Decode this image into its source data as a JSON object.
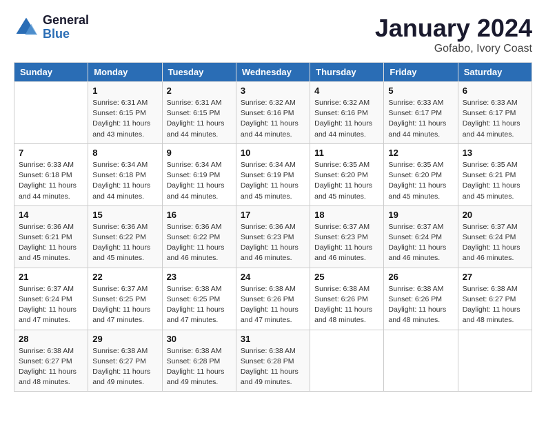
{
  "logo": {
    "line1": "General",
    "line2": "Blue"
  },
  "title": "January 2024",
  "location": "Gofabo, Ivory Coast",
  "days_of_week": [
    "Sunday",
    "Monday",
    "Tuesday",
    "Wednesday",
    "Thursday",
    "Friday",
    "Saturday"
  ],
  "weeks": [
    [
      {
        "num": "",
        "sunrise": "",
        "sunset": "",
        "daylight": ""
      },
      {
        "num": "1",
        "sunrise": "Sunrise: 6:31 AM",
        "sunset": "Sunset: 6:15 PM",
        "daylight": "Daylight: 11 hours and 43 minutes."
      },
      {
        "num": "2",
        "sunrise": "Sunrise: 6:31 AM",
        "sunset": "Sunset: 6:15 PM",
        "daylight": "Daylight: 11 hours and 44 minutes."
      },
      {
        "num": "3",
        "sunrise": "Sunrise: 6:32 AM",
        "sunset": "Sunset: 6:16 PM",
        "daylight": "Daylight: 11 hours and 44 minutes."
      },
      {
        "num": "4",
        "sunrise": "Sunrise: 6:32 AM",
        "sunset": "Sunset: 6:16 PM",
        "daylight": "Daylight: 11 hours and 44 minutes."
      },
      {
        "num": "5",
        "sunrise": "Sunrise: 6:33 AM",
        "sunset": "Sunset: 6:17 PM",
        "daylight": "Daylight: 11 hours and 44 minutes."
      },
      {
        "num": "6",
        "sunrise": "Sunrise: 6:33 AM",
        "sunset": "Sunset: 6:17 PM",
        "daylight": "Daylight: 11 hours and 44 minutes."
      }
    ],
    [
      {
        "num": "7",
        "sunrise": "Sunrise: 6:33 AM",
        "sunset": "Sunset: 6:18 PM",
        "daylight": "Daylight: 11 hours and 44 minutes."
      },
      {
        "num": "8",
        "sunrise": "Sunrise: 6:34 AM",
        "sunset": "Sunset: 6:18 PM",
        "daylight": "Daylight: 11 hours and 44 minutes."
      },
      {
        "num": "9",
        "sunrise": "Sunrise: 6:34 AM",
        "sunset": "Sunset: 6:19 PM",
        "daylight": "Daylight: 11 hours and 44 minutes."
      },
      {
        "num": "10",
        "sunrise": "Sunrise: 6:34 AM",
        "sunset": "Sunset: 6:19 PM",
        "daylight": "Daylight: 11 hours and 45 minutes."
      },
      {
        "num": "11",
        "sunrise": "Sunrise: 6:35 AM",
        "sunset": "Sunset: 6:20 PM",
        "daylight": "Daylight: 11 hours and 45 minutes."
      },
      {
        "num": "12",
        "sunrise": "Sunrise: 6:35 AM",
        "sunset": "Sunset: 6:20 PM",
        "daylight": "Daylight: 11 hours and 45 minutes."
      },
      {
        "num": "13",
        "sunrise": "Sunrise: 6:35 AM",
        "sunset": "Sunset: 6:21 PM",
        "daylight": "Daylight: 11 hours and 45 minutes."
      }
    ],
    [
      {
        "num": "14",
        "sunrise": "Sunrise: 6:36 AM",
        "sunset": "Sunset: 6:21 PM",
        "daylight": "Daylight: 11 hours and 45 minutes."
      },
      {
        "num": "15",
        "sunrise": "Sunrise: 6:36 AM",
        "sunset": "Sunset: 6:22 PM",
        "daylight": "Daylight: 11 hours and 45 minutes."
      },
      {
        "num": "16",
        "sunrise": "Sunrise: 6:36 AM",
        "sunset": "Sunset: 6:22 PM",
        "daylight": "Daylight: 11 hours and 46 minutes."
      },
      {
        "num": "17",
        "sunrise": "Sunrise: 6:36 AM",
        "sunset": "Sunset: 6:23 PM",
        "daylight": "Daylight: 11 hours and 46 minutes."
      },
      {
        "num": "18",
        "sunrise": "Sunrise: 6:37 AM",
        "sunset": "Sunset: 6:23 PM",
        "daylight": "Daylight: 11 hours and 46 minutes."
      },
      {
        "num": "19",
        "sunrise": "Sunrise: 6:37 AM",
        "sunset": "Sunset: 6:24 PM",
        "daylight": "Daylight: 11 hours and 46 minutes."
      },
      {
        "num": "20",
        "sunrise": "Sunrise: 6:37 AM",
        "sunset": "Sunset: 6:24 PM",
        "daylight": "Daylight: 11 hours and 46 minutes."
      }
    ],
    [
      {
        "num": "21",
        "sunrise": "Sunrise: 6:37 AM",
        "sunset": "Sunset: 6:24 PM",
        "daylight": "Daylight: 11 hours and 47 minutes."
      },
      {
        "num": "22",
        "sunrise": "Sunrise: 6:37 AM",
        "sunset": "Sunset: 6:25 PM",
        "daylight": "Daylight: 11 hours and 47 minutes."
      },
      {
        "num": "23",
        "sunrise": "Sunrise: 6:38 AM",
        "sunset": "Sunset: 6:25 PM",
        "daylight": "Daylight: 11 hours and 47 minutes."
      },
      {
        "num": "24",
        "sunrise": "Sunrise: 6:38 AM",
        "sunset": "Sunset: 6:26 PM",
        "daylight": "Daylight: 11 hours and 47 minutes."
      },
      {
        "num": "25",
        "sunrise": "Sunrise: 6:38 AM",
        "sunset": "Sunset: 6:26 PM",
        "daylight": "Daylight: 11 hours and 48 minutes."
      },
      {
        "num": "26",
        "sunrise": "Sunrise: 6:38 AM",
        "sunset": "Sunset: 6:26 PM",
        "daylight": "Daylight: 11 hours and 48 minutes."
      },
      {
        "num": "27",
        "sunrise": "Sunrise: 6:38 AM",
        "sunset": "Sunset: 6:27 PM",
        "daylight": "Daylight: 11 hours and 48 minutes."
      }
    ],
    [
      {
        "num": "28",
        "sunrise": "Sunrise: 6:38 AM",
        "sunset": "Sunset: 6:27 PM",
        "daylight": "Daylight: 11 hours and 48 minutes."
      },
      {
        "num": "29",
        "sunrise": "Sunrise: 6:38 AM",
        "sunset": "Sunset: 6:27 PM",
        "daylight": "Daylight: 11 hours and 49 minutes."
      },
      {
        "num": "30",
        "sunrise": "Sunrise: 6:38 AM",
        "sunset": "Sunset: 6:28 PM",
        "daylight": "Daylight: 11 hours and 49 minutes."
      },
      {
        "num": "31",
        "sunrise": "Sunrise: 6:38 AM",
        "sunset": "Sunset: 6:28 PM",
        "daylight": "Daylight: 11 hours and 49 minutes."
      },
      {
        "num": "",
        "sunrise": "",
        "sunset": "",
        "daylight": ""
      },
      {
        "num": "",
        "sunrise": "",
        "sunset": "",
        "daylight": ""
      },
      {
        "num": "",
        "sunrise": "",
        "sunset": "",
        "daylight": ""
      }
    ]
  ]
}
